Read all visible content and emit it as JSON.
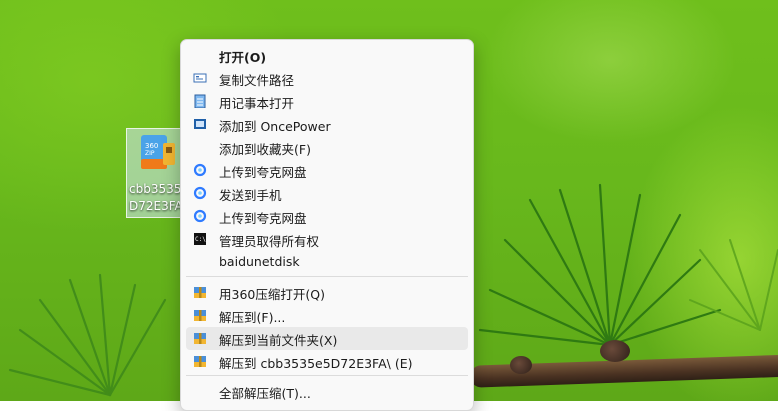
{
  "desktop": {
    "file_icon": {
      "name_line1": "cbb3535",
      "name_line2": "D72E3FA",
      "icon": "360zip-archive-icon"
    }
  },
  "context_menu": {
    "items": [
      {
        "label": "打开(O)",
        "icon": "",
        "bold": true
      },
      {
        "label": "复制文件路径",
        "icon": "copy-path-icon"
      },
      {
        "label": "用记事本打开",
        "icon": "notepad-icon"
      },
      {
        "label": "添加到 OncePower",
        "icon": "oncepower-icon"
      },
      {
        "label": "添加到收藏夹(F)",
        "icon": ""
      },
      {
        "label": "上传到夸克网盘",
        "icon": "quark-cloud-icon"
      },
      {
        "label": "发送到手机",
        "icon": "quark-cloud-icon"
      },
      {
        "label": "上传到夸克网盘",
        "icon": "quark-cloud-icon"
      },
      {
        "label": "管理员取得所有权",
        "icon": "admin-cmd-icon"
      },
      {
        "label": "baidunetdisk",
        "icon": ""
      },
      {
        "label": "用360压缩打开(Q)",
        "icon": "360zip-icon"
      },
      {
        "label": "解压到(F)...",
        "icon": "360zip-icon"
      },
      {
        "label": "解压到当前文件夹(X)",
        "icon": "360zip-icon",
        "highlighted": true
      },
      {
        "label": "解压到 cbb3535e5D72E3FA\\ (E)",
        "icon": "360zip-icon"
      },
      {
        "label": "全部解压缩(T)...",
        "icon": ""
      }
    ]
  },
  "colors": {
    "menu_bg": "#f9f9f9",
    "highlight": "#e9e9e9",
    "cloud_blue": "#2f7bff",
    "zip_yellow": "#f2b632"
  }
}
